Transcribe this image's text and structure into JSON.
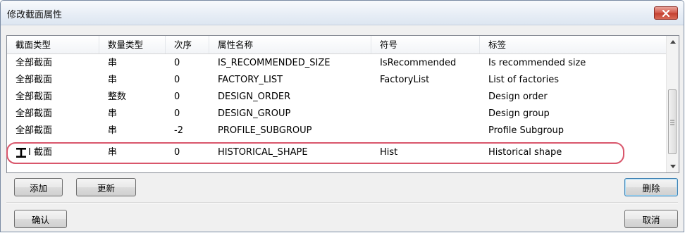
{
  "window": {
    "title": "修改截面属性"
  },
  "table": {
    "columns": [
      "截面类型",
      "数量类型",
      "次序",
      "属性名称",
      "符号",
      "标签"
    ],
    "rows": [
      {
        "type": "全部截面",
        "qty": "串",
        "order": "0",
        "name": "IS_RECOMMENDED_SIZE",
        "symbol": "IsRecommended",
        "label": "Is recommended size"
      },
      {
        "type": "全部截面",
        "qty": "串",
        "order": "0",
        "name": "FACTORY_LIST",
        "symbol": "FactoryList",
        "label": "List of factories"
      },
      {
        "type": "全部截面",
        "qty": "整数",
        "order": "0",
        "name": "DESIGN_ORDER",
        "symbol": "",
        "label": "Design order"
      },
      {
        "type": "全部截面",
        "qty": "串",
        "order": "0",
        "name": "DESIGN_GROUP",
        "symbol": "",
        "label": "Design group"
      },
      {
        "type": "全部截面",
        "qty": "串",
        "order": "-2",
        "name": "PROFILE_SUBGROUP",
        "symbol": "",
        "label": "Profile Subgroup"
      },
      {
        "type": "I 截面",
        "qty": "串",
        "order": "0",
        "name": "HISTORICAL_SHAPE",
        "symbol": "Hist",
        "label": "Historical shape",
        "icon": "i-beam-icon"
      }
    ]
  },
  "buttons": {
    "add": "添加",
    "update": "更新",
    "delete": "删除",
    "confirm": "确认",
    "cancel": "取消"
  },
  "colors": {
    "highlight": "#d9566b",
    "close": "#c33f30"
  }
}
